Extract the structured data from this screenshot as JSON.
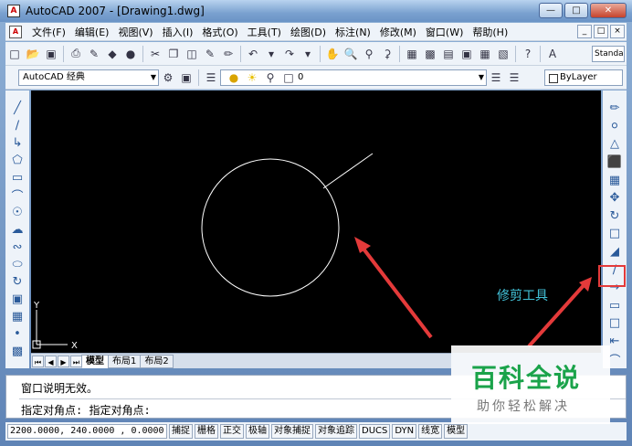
{
  "window": {
    "title": "AutoCAD 2007 - [Drawing1.dwg]",
    "controls": [
      "minimize",
      "maximize",
      "close"
    ]
  },
  "menu": {
    "items": [
      "文件(F)",
      "编辑(E)",
      "视图(V)",
      "插入(I)",
      "格式(O)",
      "工具(T)",
      "绘图(D)",
      "标注(N)",
      "修改(M)",
      "窗口(W)",
      "帮助(H)"
    ]
  },
  "toolbar": {
    "text_style_field": "Standa"
  },
  "workspace": {
    "current": "AutoCAD 经典"
  },
  "layer": {
    "current": "0"
  },
  "properties": {
    "color": "ByLayer"
  },
  "canvas": {
    "background": "#000000",
    "annotation": "修剪工具",
    "annotation_color": "#42c1d7",
    "arrow_color": "#e43a3a",
    "ucs_x": "X",
    "ucs_y": "Y"
  },
  "layout_tabs": [
    "模型",
    "布局1",
    "布局2"
  ],
  "command": {
    "line1": "窗口说明无效。",
    "line2": "指定对角点: 指定对角点:"
  },
  "status": {
    "coordinates": "2200.0000, 240.0000 , 0.0000",
    "toggles": [
      "捕捉",
      "栅格",
      "正交",
      "极轴",
      "对象捕捉",
      "对象追踪",
      "DUCS",
      "DYN",
      "线宽",
      "模型"
    ]
  },
  "watermark": {
    "title": "百科全说",
    "subtitle": "助你轻松解决",
    "color": "#1aa34a"
  }
}
